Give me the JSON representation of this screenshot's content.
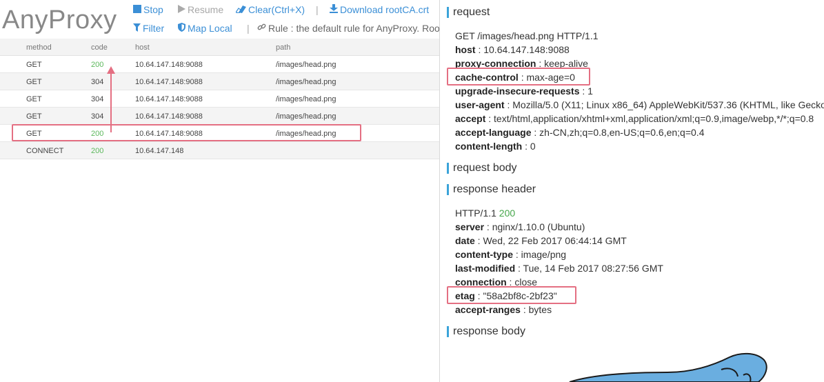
{
  "app": {
    "logo": "AnyProxy"
  },
  "toolbar": {
    "stop": "Stop",
    "resume": "Resume",
    "clear": "Clear(Ctrl+X)",
    "download": "Download rootCA.crt",
    "filter": "Filter",
    "map_local": "Map Local",
    "rule": "Rule : the default rule for AnyProxy. Roo",
    "separator": "|"
  },
  "grid": {
    "columns": {
      "method": "method",
      "code": "code",
      "host": "host",
      "path": "path"
    },
    "rows": [
      {
        "method": "GET",
        "code": "200",
        "host": "10.64.147.148:9088",
        "path": "/images/head.png"
      },
      {
        "method": "GET",
        "code": "304",
        "host": "10.64.147.148:9088",
        "path": "/images/head.png"
      },
      {
        "method": "GET",
        "code": "304",
        "host": "10.64.147.148:9088",
        "path": "/images/head.png"
      },
      {
        "method": "GET",
        "code": "304",
        "host": "10.64.147.148:9088",
        "path": "/images/head.png"
      },
      {
        "method": "GET",
        "code": "200",
        "host": "10.64.147.148:9088",
        "path": "/images/head.png"
      },
      {
        "method": "CONNECT",
        "code": "200",
        "host": "10.64.147.148",
        "path": ""
      }
    ]
  },
  "detail": {
    "request_title": "request",
    "request_line": "GET /images/head.png HTTP/1.1",
    "request_headers": [
      {
        "k": "host",
        "v": "10.64.147.148:9088"
      },
      {
        "k": "proxy-connection",
        "v": "keep-alive"
      },
      {
        "k": "cache-control",
        "v": "max-age=0"
      },
      {
        "k": "upgrade-insecure-requests",
        "v": "1"
      },
      {
        "k": "user-agent",
        "v": "Mozilla/5.0 (X11; Linux x86_64) AppleWebKit/537.36 (KHTML, like Gecko"
      },
      {
        "k": "accept",
        "v": "text/html,application/xhtml+xml,application/xml;q=0.9,image/webp,*/*;q=0.8"
      },
      {
        "k": "accept-language",
        "v": "zh-CN,zh;q=0.8,en-US;q=0.6,en;q=0.4"
      },
      {
        "k": "content-length",
        "v": "0"
      }
    ],
    "request_body_title": "request body",
    "response_header_title": "response header",
    "status_proto": "HTTP/1.1",
    "status_code": "200",
    "response_headers": [
      {
        "k": "server",
        "v": "nginx/1.10.0 (Ubuntu)"
      },
      {
        "k": "date",
        "v": "Wed, 22 Feb 2017 06:44:14 GMT"
      },
      {
        "k": "content-type",
        "v": "image/png"
      },
      {
        "k": "last-modified",
        "v": "Tue, 14 Feb 2017 08:27:56 GMT"
      },
      {
        "k": "connection",
        "v": "close"
      },
      {
        "k": "etag",
        "v": "\"58a2bf8c-2bf23\""
      },
      {
        "k": "accept-ranges",
        "v": "bytes"
      }
    ],
    "response_body_title": "response body"
  },
  "colors": {
    "accent": "#3b8fd6",
    "highlight": "#e46f82",
    "status_ok": "#5cb85c",
    "section_bar": "#3aa3d9"
  },
  "icons": {
    "stop": "stop-square-icon",
    "resume": "play-icon",
    "clear": "eraser-icon",
    "download": "download-icon",
    "filter": "filter-icon",
    "map_local": "shield-icon",
    "rule": "link-icon"
  }
}
